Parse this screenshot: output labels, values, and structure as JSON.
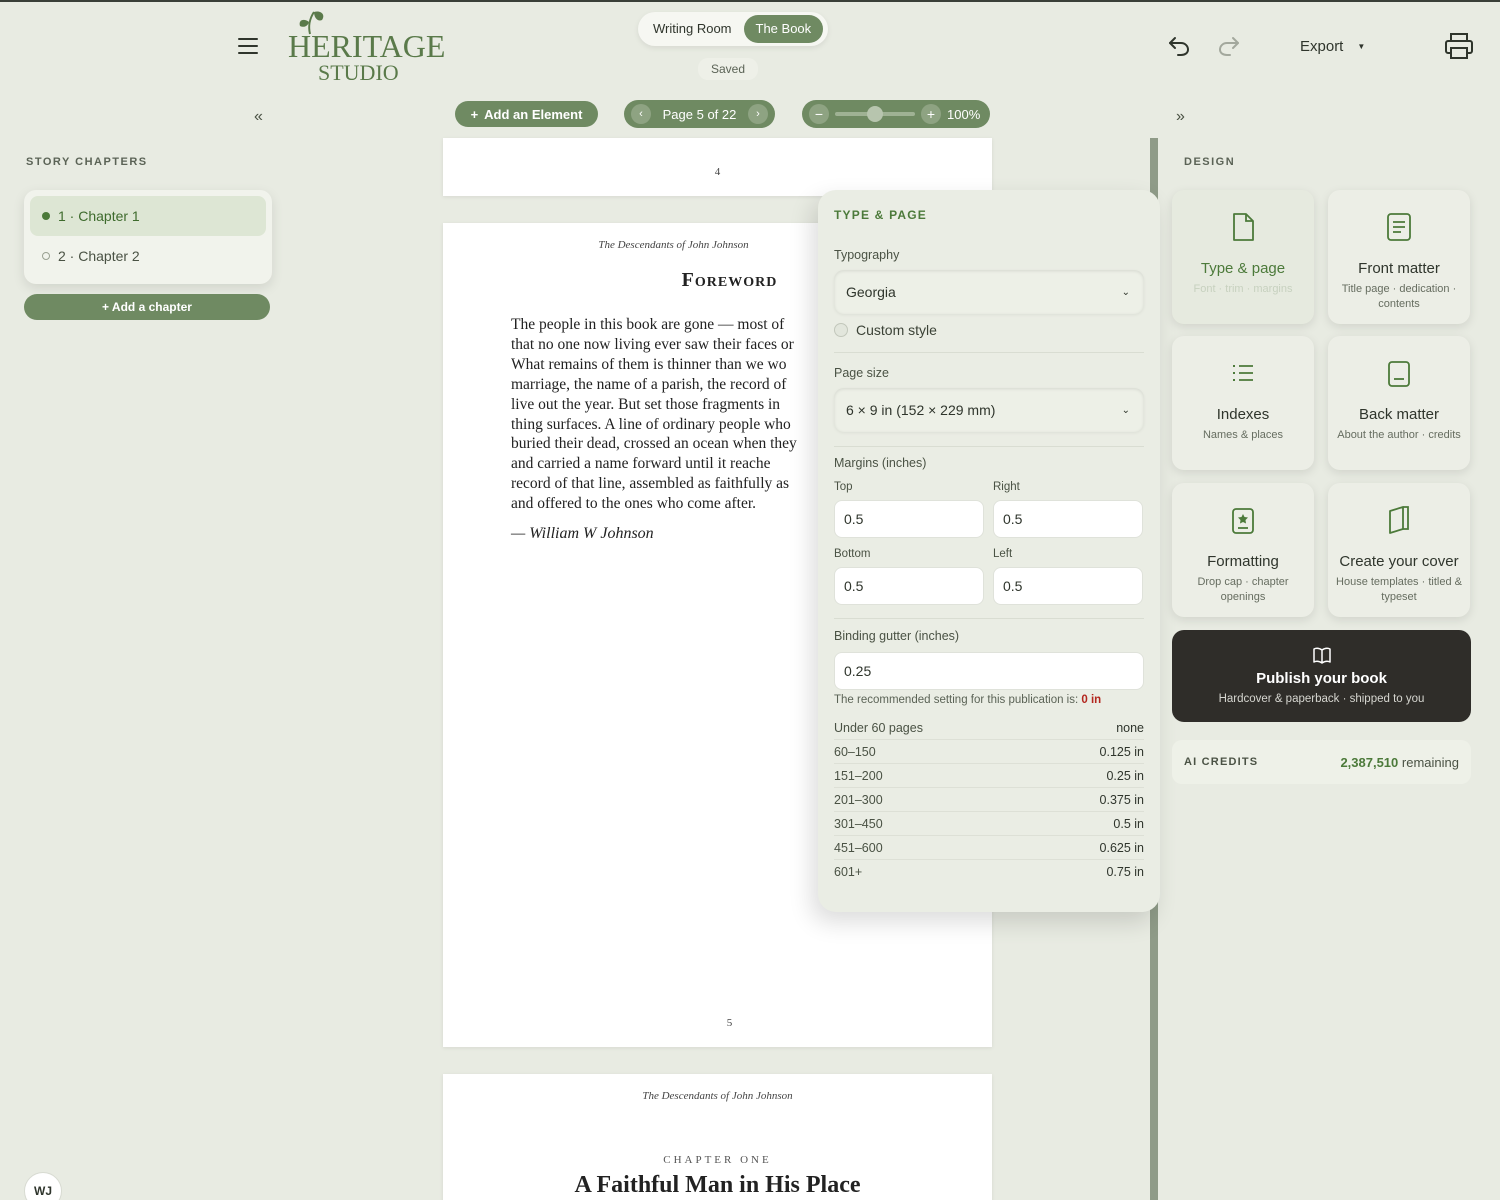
{
  "header": {
    "logo_line1": "HERITAGE",
    "logo_line2": "STUDIO",
    "modes": [
      {
        "label": "Writing Room"
      },
      {
        "label": "The Book"
      }
    ],
    "save_status": "Saved",
    "export_label": "Export"
  },
  "toolbar": {
    "add_element_label": "Add an Element",
    "page_indicator": "Page 5 of 22",
    "zoom_level": "100%",
    "zoom_fraction": 0.5
  },
  "sidebar": {
    "section_label": "STORY CHAPTERS",
    "chapters": [
      {
        "label": "1 · Chapter 1"
      },
      {
        "label": "2 · Chapter 2"
      }
    ],
    "add_chapter_label": "+ Add a chapter",
    "user_initials": "WJ"
  },
  "book": {
    "prev_page_number": "4",
    "running_head": "The Descendants of John Johnson",
    "foreword_title": "Foreword",
    "foreword_lines": [
      "The people in this book are gone — most of",
      "that no one now living ever saw their faces or",
      "What remains of them is thinner than we wo",
      "marriage, the name of a parish, the record of",
      "live out the year. But set those fragments in",
      "thing surfaces. A line of ordinary people who",
      "buried their dead, crossed an ocean when they",
      "and carried a name forward until it reache",
      "record of that line, assembled as faithfully as",
      "and offered to the ones who come after."
    ],
    "signature": "— William W Johnson",
    "page_number": "5",
    "next_running_head": "The Descendants of John Johnson",
    "chapter_kicker": "CHAPTER ONE",
    "chapter_title": "A Faithful Man in His Place"
  },
  "type_page_panel": {
    "title": "TYPE & PAGE",
    "typography_label": "Typography",
    "typography_value": "Georgia",
    "custom_style_label": "Custom style",
    "page_size_label": "Page size",
    "page_size_value": "6 × 9 in (152 × 229 mm)",
    "margins_label": "Margins (inches)",
    "margins": {
      "top_label": "Top",
      "top": "0.5",
      "right_label": "Right",
      "right": "0.5",
      "bottom_label": "Bottom",
      "bottom": "0.5",
      "left_label": "Left",
      "left": "0.5"
    },
    "gutter_label": "Binding gutter (inches)",
    "gutter_value": "0.25",
    "recommended_text": "The recommended setting for this publication is:",
    "recommended_value": "0 in",
    "gutter_table": [
      {
        "pages": "Under 60 pages",
        "value": "none"
      },
      {
        "pages": "60–150",
        "value": "0.125 in"
      },
      {
        "pages": "151–200",
        "value": "0.25 in"
      },
      {
        "pages": "201–300",
        "value": "0.375 in"
      },
      {
        "pages": "301–450",
        "value": "0.5 in"
      },
      {
        "pages": "451–600",
        "value": "0.625 in"
      },
      {
        "pages": "601+",
        "value": "0.75 in"
      }
    ]
  },
  "design": {
    "section_label": "DESIGN",
    "tiles": [
      {
        "title": "Type & page",
        "subtitle": "Font · trim · margins",
        "icon": "document-icon"
      },
      {
        "title": "Front matter",
        "subtitle": "Title page · dedication · contents",
        "icon": "text-page-icon"
      },
      {
        "title": "Indexes",
        "subtitle": "Names & places",
        "icon": "list-icon"
      },
      {
        "title": "Back matter",
        "subtitle": "About the author · credits",
        "icon": "page-footer-icon"
      },
      {
        "title": "Formatting",
        "subtitle": "Drop cap · chapter openings",
        "icon": "format-icon"
      },
      {
        "title": "Create your cover",
        "subtitle": "House templates · titled & typeset",
        "icon": "book-cover-icon"
      }
    ],
    "publish_title": "Publish your book",
    "publish_subtitle": "Hardcover & paperback · shipped to you",
    "credits_label": "AI CREDITS",
    "credits_value": "2,387,510",
    "credits_suffix": "remaining"
  },
  "colors": {
    "accent": "#6f8a62",
    "accent_dark": "#4c7a3a",
    "background": "#e8ebe2",
    "publish_bg": "#2f2d29",
    "warning": "#b3261e"
  }
}
